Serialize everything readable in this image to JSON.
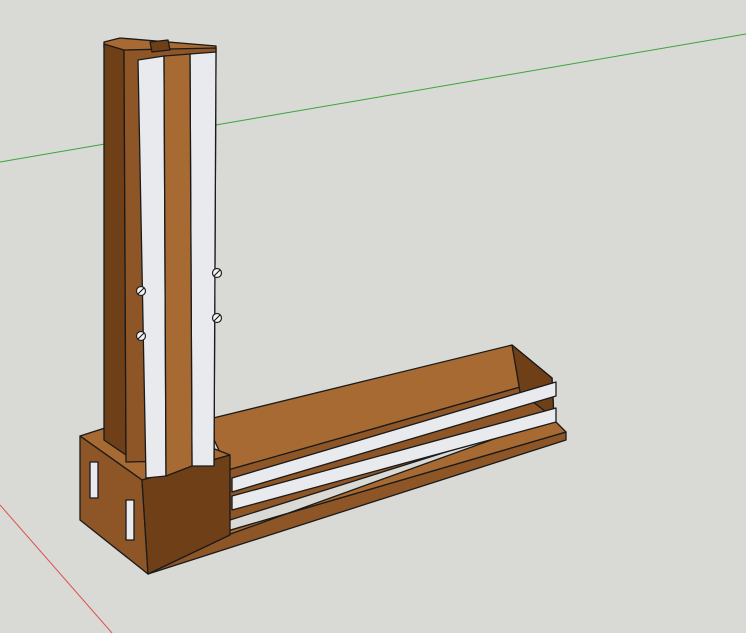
{
  "viewport": {
    "background": "#d9d9d5"
  },
  "axes": {
    "green_axis_color": "#3aa53a",
    "red_axis_color": "#e05050"
  },
  "model": {
    "wood_light": "#a66a32",
    "wood_mid": "#8e5626",
    "wood_dark": "#6f3f18",
    "aluminum": "#e8eaee",
    "aluminum_shade": "#cdd0d6"
  }
}
